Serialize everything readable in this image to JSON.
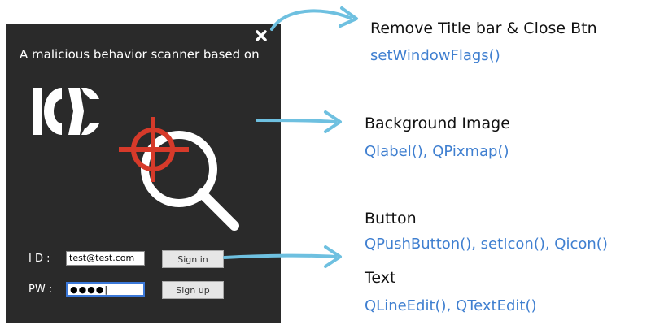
{
  "window": {
    "title": "A malicious behavior scanner based on",
    "close_glyph": "✖",
    "id_label": "I D :",
    "pw_label": "PW :",
    "id_value": "test@test.com",
    "pw_value": "●●●●|",
    "sign_in_label": "Sign in",
    "sign_up_label": "Sign up"
  },
  "annotations": {
    "titlebar": {
      "heading": "Remove Title bar & Close Btn",
      "api": "setWindowFlags()"
    },
    "background": {
      "heading": "Background Image",
      "api": "Qlabel(), QPixmap()"
    },
    "button": {
      "heading": "Button",
      "api": "QPushButton(), setIcon(), Qicon()"
    },
    "text": {
      "heading": "Text",
      "api": "QLineEdit(), QTextEdit()"
    }
  },
  "colors": {
    "window_bg": "#2a2a2a",
    "crosshair_red": "#d63a2a",
    "api_blue": "#3f7fd0",
    "arrow_blue": "#6ec0e0"
  }
}
